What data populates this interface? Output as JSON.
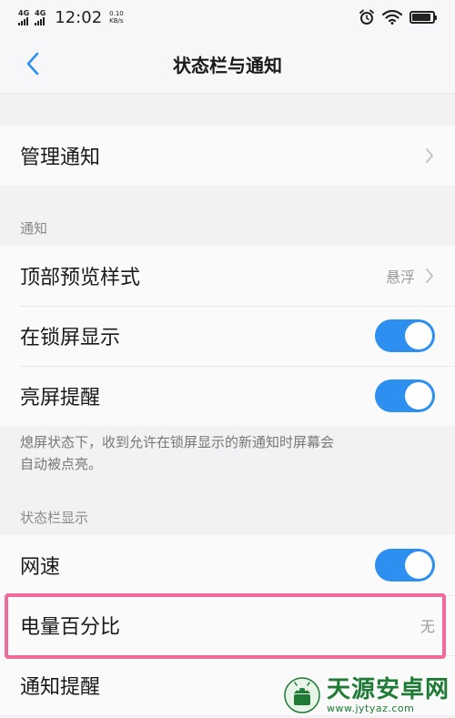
{
  "status_bar": {
    "network_1": "4G",
    "network_2": "4G",
    "time": "12:02",
    "speed_value": "0.10",
    "speed_unit": "KB/s",
    "icons": [
      "alarm-icon",
      "wifi-icon",
      "battery-icon"
    ],
    "battery_level": 0.9
  },
  "nav": {
    "back_icon": "chevron-left-icon",
    "title": "状态栏与通知"
  },
  "manage": {
    "label": "管理通知",
    "chevron": "chevron-right-icon"
  },
  "notification_section": {
    "header": "通知",
    "preview": {
      "label": "顶部预览样式",
      "value": "悬浮"
    },
    "lockscreen": {
      "label": "在锁屏显示",
      "enabled": true
    },
    "wake": {
      "label": "亮屏提醒",
      "enabled": true
    },
    "description_line1": "熄屏状态下，收到允许在锁屏显示的新通知时屏幕会",
    "description_line2": "自动被点亮。"
  },
  "statusbar_section": {
    "header": "状态栏显示",
    "speed": {
      "label": "网速",
      "enabled": true
    },
    "battery_percent": {
      "label": "电量百分比",
      "value": "无"
    },
    "notify": {
      "label": "通知提醒"
    }
  },
  "watermark": {
    "name": "天源安卓网",
    "url": "www.jytyaz.com"
  },
  "colors": {
    "accent": "#2d8ff0",
    "highlight": "#ee6b9a",
    "watermark": "#1e7a34",
    "back_arrow": "#2d8ff0"
  }
}
